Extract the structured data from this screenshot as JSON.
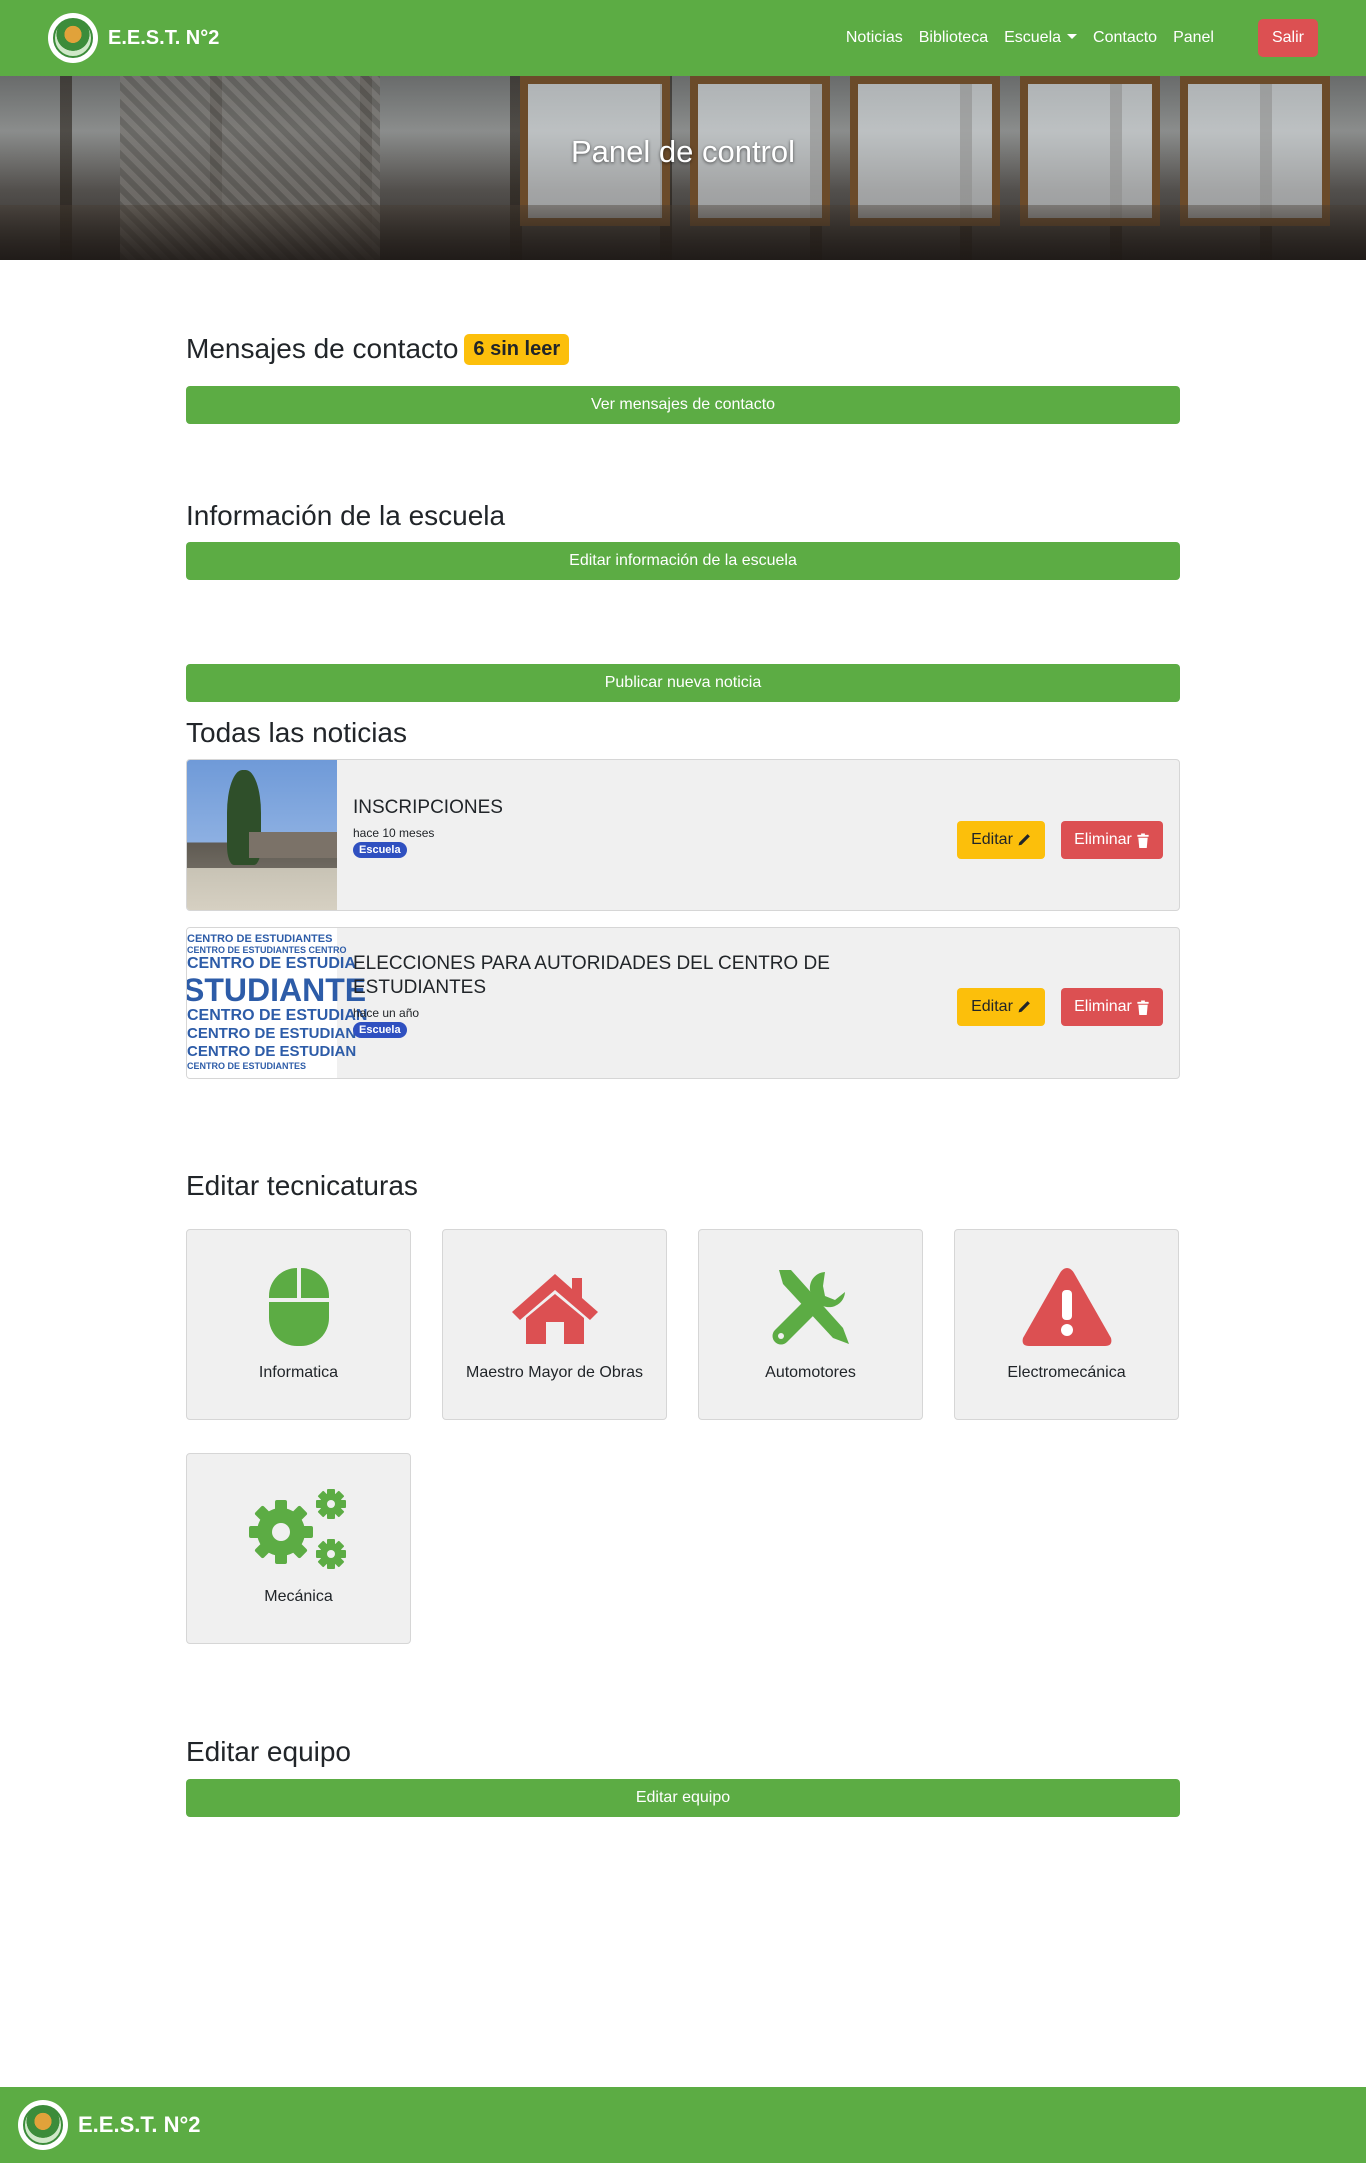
{
  "navbar": {
    "brand": "E.E.S.T. N°2",
    "links": [
      "Noticias",
      "Biblioteca",
      "Escuela",
      "Contacto",
      "Panel"
    ],
    "logout": "Salir"
  },
  "hero": {
    "title": "Panel de control"
  },
  "contact": {
    "title": "Mensajes de contacto",
    "unread_badge": "6 sin leer",
    "button": "Ver mensajes de contacto"
  },
  "school_info": {
    "title": "Información de la escuela",
    "button": "Editar información de la escuela"
  },
  "news": {
    "publish_button": "Publicar nueva noticia",
    "title": "Todas las noticias",
    "items": [
      {
        "title": "INSCRIPCIONES",
        "date": "hace 10 meses",
        "category": "Escuela",
        "edit": "Editar",
        "delete": "Eliminar"
      },
      {
        "title": "ELECCIONES PARA AUTORIDADES DEL CENTRO DE ESTUDIANTES",
        "date": "hace un año",
        "category": "Escuela",
        "edit": "Editar",
        "delete": "Eliminar"
      }
    ]
  },
  "tecnicaturas": {
    "title": "Editar tecnicaturas",
    "items": [
      {
        "label": "Informatica",
        "icon": "mouse-icon",
        "color": "#5cac44"
      },
      {
        "label": "Maestro Mayor de Obras",
        "icon": "house-icon",
        "color": "#dc5052"
      },
      {
        "label": "Automotores",
        "icon": "tools-icon",
        "color": "#5cac44"
      },
      {
        "label": "Electromecánica",
        "icon": "warning-icon",
        "color": "#dc5052"
      },
      {
        "label": "Mecánica",
        "icon": "gears-icon",
        "color": "#5cac44"
      }
    ]
  },
  "team": {
    "title": "Editar equipo",
    "button": "Editar equipo"
  },
  "footer": {
    "brand": "E.E.S.T. N°2"
  },
  "colors": {
    "primary_green": "#5cac44",
    "danger_red": "#dc5052",
    "warning_yellow": "#fcbf0b",
    "badge_blue": "#2f50c0"
  }
}
